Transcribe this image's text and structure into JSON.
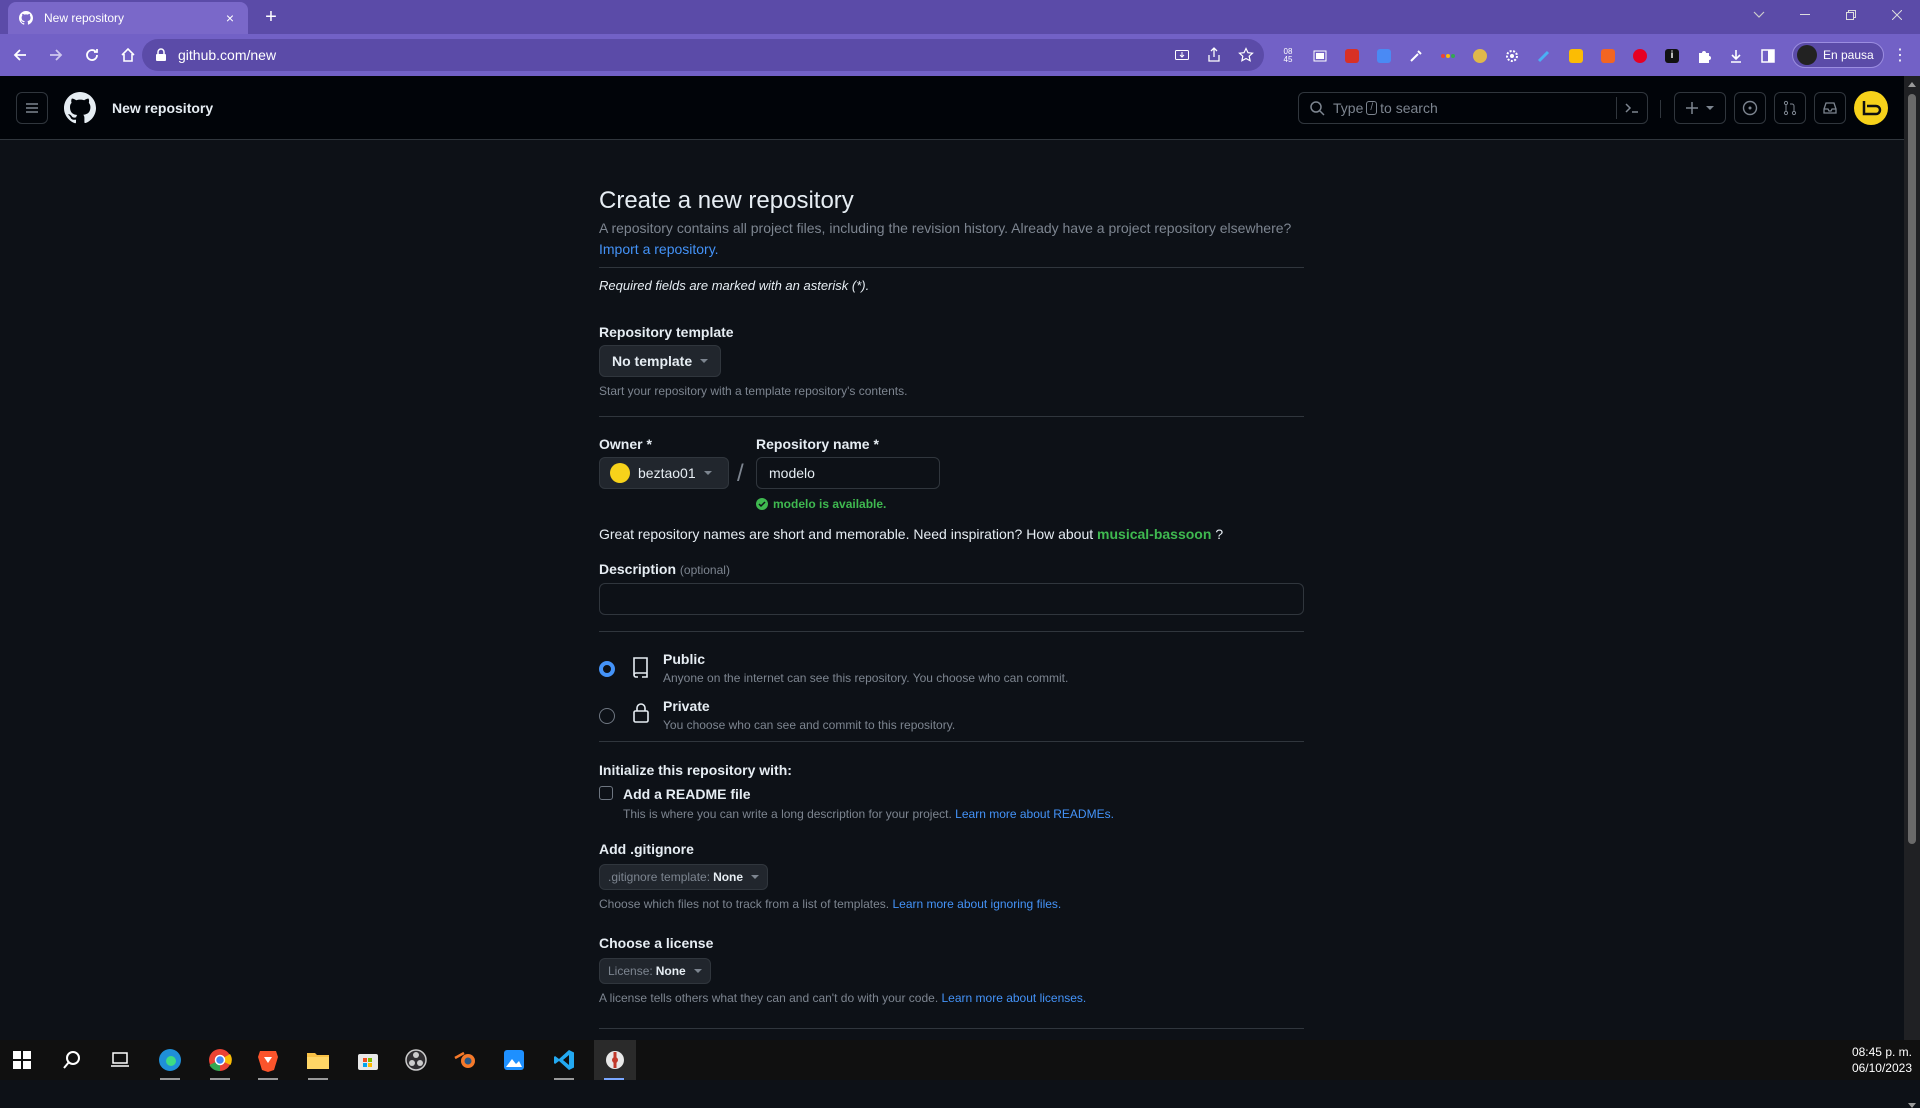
{
  "browser": {
    "tab_title": "New repository",
    "tab_close": "×",
    "new_tab": "+",
    "url": "github.com/new",
    "profile_label": "En pausa",
    "menu": "⋮",
    "window_controls": [
      "﹀",
      "—",
      "❐",
      "✕"
    ],
    "extension_badge": "08\n45"
  },
  "header": {
    "context": "New repository",
    "search_prefix": "Type",
    "search_key": "/",
    "search_suffix": "to search"
  },
  "form": {
    "title": "Create a new repository",
    "subtitle": "A repository contains all project files, including the revision history. Already have a project repository elsewhere?",
    "import_link": "Import a repository.",
    "required_note": "Required fields are marked with an asterisk (*).",
    "template_label": "Repository template",
    "template_value": "No template",
    "template_note": "Start your repository with a template repository's contents.",
    "owner_label": "Owner *",
    "owner_value": "beztao01",
    "repo_name_label": "Repository name *",
    "repo_name_value": "modelo",
    "slash": "/",
    "availability": "modelo is available.",
    "inspiration_text": "Great repository names are short and memorable. Need inspiration? How about",
    "inspiration_suggestion": "musical-bassoon",
    "inspiration_end": "?",
    "description_label": "Description",
    "description_optional": "(optional)",
    "description_value": "",
    "visibility": {
      "public_title": "Public",
      "public_desc": "Anyone on the internet can see this repository. You choose who can commit.",
      "private_title": "Private",
      "private_desc": "You choose who can see and commit to this repository.",
      "selected": "public"
    },
    "init_label": "Initialize this repository with:",
    "readme_label": "Add a README file",
    "readme_desc": "This is where you can write a long description for your project.",
    "readme_link": "Learn more about READMEs.",
    "gitignore_label": "Add .gitignore",
    "gitignore_select_prefix": ".gitignore template:",
    "gitignore_select_value": "None",
    "gitignore_note": "Choose which files not to track from a list of templates.",
    "gitignore_link": "Learn more about ignoring files.",
    "license_label": "Choose a license",
    "license_select_prefix": "License:",
    "license_select_value": "None",
    "license_note": "A license tells others what they can and can't do with your code.",
    "license_link": "Learn more about licenses."
  },
  "taskbar": {
    "time": "08:45 p. m.",
    "date": "06/10/2023",
    "apps": [
      "windows-start",
      "search",
      "task-view",
      "edge",
      "chrome",
      "brave",
      "file-explorer",
      "microsoft-store",
      "obs",
      "blender",
      "photos",
      "vscode",
      "app-active"
    ]
  },
  "colors": {
    "accent_link": "#4493f8",
    "success": "#3fb950",
    "chrome_purple": "#7261c6",
    "page_bg": "#0d1117"
  }
}
